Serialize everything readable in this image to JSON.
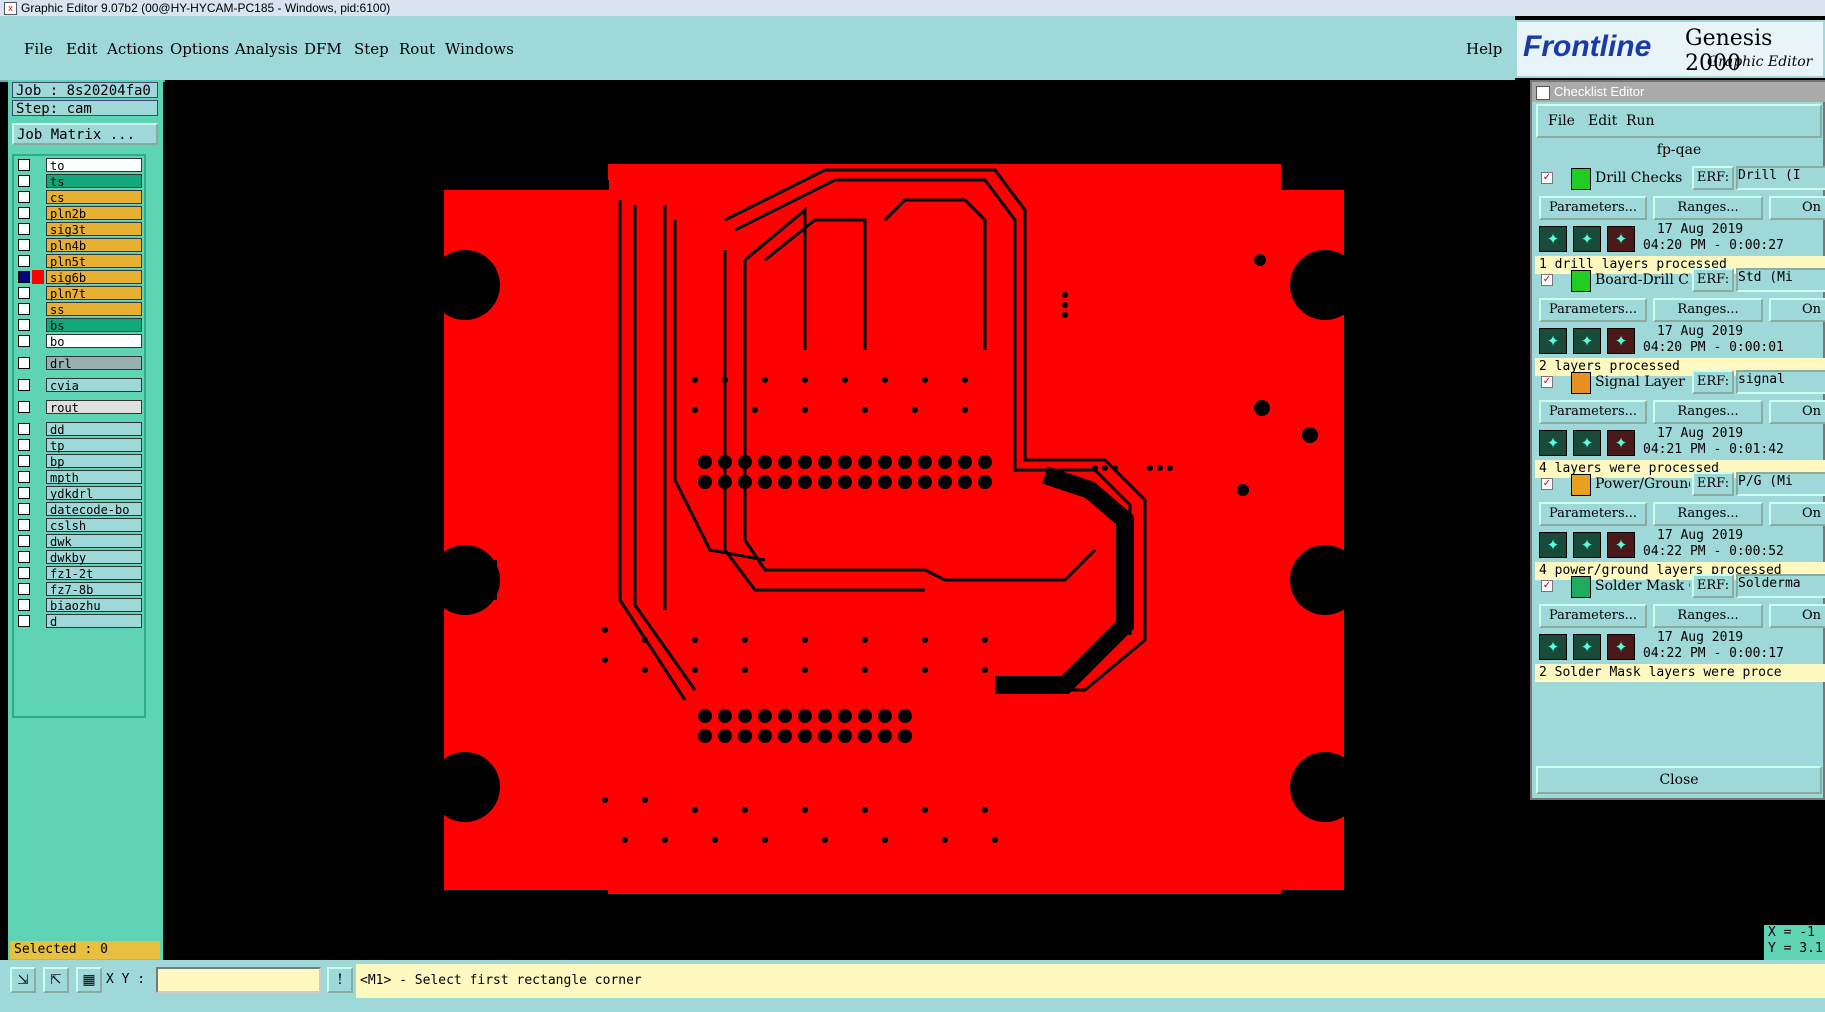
{
  "window": {
    "title": "Graphic Editor 9.07b2 (00@HY-HYCAM-PC185 - Windows, pid:6100)"
  },
  "menu": {
    "items": [
      "File",
      "Edit",
      "Actions",
      "Options",
      "Analysis",
      "DFM",
      "Step",
      "Rout",
      "Windows"
    ],
    "help": "Help"
  },
  "brand": {
    "logo": "Frontline",
    "product": "Genesis 2000",
    "subtitle": "Graphic Editor"
  },
  "left": {
    "job": "Job : 8s20204fa0",
    "step": "Step: cam",
    "job_matrix": "Job Matrix ...",
    "layers": [
      {
        "name": "to",
        "color": "#ffffff"
      },
      {
        "name": "ts",
        "color": "#12a87a"
      },
      {
        "name": "cs",
        "color": "#e8b030"
      },
      {
        "name": "pln2b",
        "color": "#e8b030"
      },
      {
        "name": "sig3t",
        "color": "#e8b030"
      },
      {
        "name": "pln4b",
        "color": "#e8b030"
      },
      {
        "name": "pln5t",
        "color": "#e8b030"
      },
      {
        "name": "sig6b",
        "color": "#e8b030",
        "active": true
      },
      {
        "name": "pln7t",
        "color": "#e8b030"
      },
      {
        "name": "ss",
        "color": "#e8b030"
      },
      {
        "name": "bs",
        "color": "#12a87a"
      },
      {
        "name": "bo",
        "color": "#ffffff"
      },
      {
        "name": "drl",
        "color": "#9ab0b0"
      },
      {
        "name": "cvia",
        "color": "#9ed8d8"
      },
      {
        "name": "rout",
        "color": "#e0e0e0"
      },
      {
        "name": "dd",
        "color": "#9ed8d8"
      },
      {
        "name": "tp",
        "color": "#9ed8d8"
      },
      {
        "name": "bp",
        "color": "#9ed8d8"
      },
      {
        "name": "mpth",
        "color": "#9ed8d8"
      },
      {
        "name": "ydkdrl",
        "color": "#9ed8d8"
      },
      {
        "name": "datecode-bo",
        "color": "#9ed8d8"
      },
      {
        "name": "cslsh",
        "color": "#9ed8d8"
      },
      {
        "name": "dwk",
        "color": "#9ed8d8"
      },
      {
        "name": "dwkby",
        "color": "#9ed8d8"
      },
      {
        "name": "fz1-2t",
        "color": "#9ed8d8"
      },
      {
        "name": "fz7-8b",
        "color": "#9ed8d8"
      },
      {
        "name": "biaozhu",
        "color": "#9ed8d8"
      },
      {
        "name": "d",
        "color": "#9ed8d8"
      }
    ],
    "selected": "Selected : 0"
  },
  "checklist": {
    "title": "Checklist Editor",
    "menu": [
      "File",
      "Edit",
      "Run"
    ],
    "name": "fp-qae",
    "close": "Close",
    "params_label": "Parameters...",
    "ranges_label": "Ranges...",
    "on_label": "On",
    "erf_label": "ERF:",
    "checks": [
      {
        "name": "Drill Checks",
        "erf": "Drill (I",
        "date": "17 Aug 2019",
        "time": "04:20 PM - 0:00:27",
        "status": "1 drill layers processed"
      },
      {
        "name": "Board-Drill Che",
        "erf": "Std (Mi",
        "date": "17 Aug 2019",
        "time": "04:20 PM - 0:00:01",
        "status": "2 layers processed"
      },
      {
        "name": "Signal Layer Ch",
        "erf": "signal",
        "date": "17 Aug 2019",
        "time": "04:21 PM - 0:01:42",
        "status": "4 layers were processed"
      },
      {
        "name": "Power/Ground C",
        "erf": "P/G (Mi",
        "date": "17 Aug 2019",
        "time": "04:22 PM - 0:00:52",
        "status": "4 power/ground layers processed"
      },
      {
        "name": "Solder Mask Ch",
        "erf": "Solderma",
        "date": "17 Aug 2019",
        "time": "04:22 PM - 0:00:17",
        "status": "2 Solder Mask layers were proce"
      }
    ]
  },
  "bottom": {
    "xy_label": "X Y :",
    "xy_value": "",
    "prompt": "<M1> - Select first rectangle corner",
    "coord_x": "X = -1",
    "coord_y": "Y = 3.1"
  },
  "colors": {
    "board": "#ff0000",
    "trace": "#000000",
    "panel": "#9ed8d8",
    "accent": "#5fd4b4"
  }
}
